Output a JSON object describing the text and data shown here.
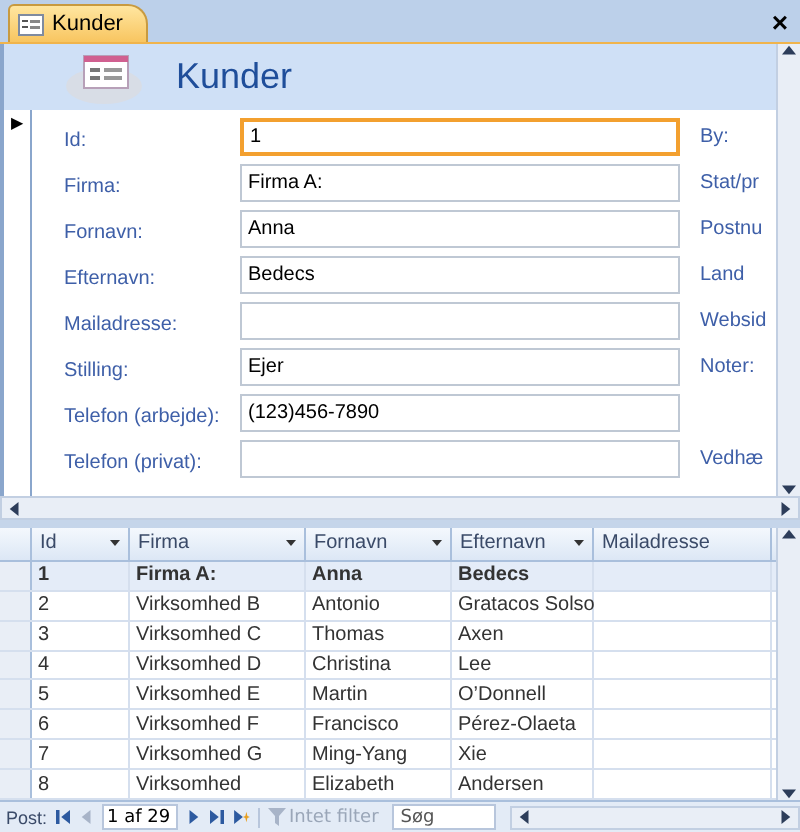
{
  "tab": {
    "label": "Kunder",
    "selected": true,
    "close": "×"
  },
  "form": {
    "title": "Kunder",
    "record_marker": "▶",
    "fields": [
      {
        "label": "Id:",
        "value": "1",
        "focused": true,
        "side_label": "By:"
      },
      {
        "label": "Firma:",
        "value": "Firma A:",
        "focused": false,
        "side_label": "Stat/pr"
      },
      {
        "label": "Fornavn:",
        "value": "Anna",
        "focused": false,
        "side_label": "Postnu"
      },
      {
        "label": "Efternavn:",
        "value": "Bedecs",
        "focused": false,
        "side_label": "Land"
      },
      {
        "label": "Mailadresse:",
        "focused": false,
        "side_label": "Websid"
      },
      {
        "label": "Stilling:",
        "value": "Ejer",
        "focused": false,
        "side_label": "Noter:"
      },
      {
        "label": "Telefon (arbejde):",
        "value": "(123)456-7890",
        "focused": false
      },
      {
        "label": "Telefon (privat):",
        "focused": false,
        "side_label": "Vedhæ"
      }
    ]
  },
  "datasheet": {
    "columns": [
      {
        "label": "Id",
        "dropdown": true
      },
      {
        "label": "Firma",
        "dropdown": true
      },
      {
        "label": "Fornavn",
        "dropdown": true
      },
      {
        "label": "Efternavn",
        "dropdown": true
      },
      {
        "label": "Mailadresse",
        "dropdown": false
      }
    ],
    "rows": [
      {
        "selected": true,
        "cells": [
          "1",
          "Firma A:",
          "Anna",
          "Bedecs"
        ]
      },
      {
        "selected": false,
        "cells": [
          "2",
          "Virksomhed B",
          "Antonio",
          "Gratacos Solso"
        ]
      },
      {
        "selected": false,
        "cells": [
          "3",
          "Virksomhed C",
          "Thomas",
          "Axen"
        ]
      },
      {
        "selected": false,
        "cells": [
          "4",
          "Virksomhed D",
          "Christina",
          "Lee"
        ]
      },
      {
        "selected": false,
        "cells": [
          "5",
          "Virksomhed E",
          "Martin",
          "O’Donnell"
        ]
      },
      {
        "selected": false,
        "cells": [
          "6",
          "Virksomhed F",
          "Francisco",
          "Pérez-Olaeta"
        ]
      },
      {
        "selected": false,
        "cells": [
          "7",
          "Virksomhed G",
          "Ming-Yang",
          "Xie"
        ]
      },
      {
        "selected": false,
        "cells": [
          "8",
          "Virksomhed",
          "Elizabeth",
          "Andersen"
        ]
      }
    ]
  },
  "navigator": {
    "label": "Post:",
    "position": "1 af 29",
    "filter": {
      "label": "Intet filter",
      "disabled": true
    },
    "search": {
      "placeholder": "Søg"
    }
  }
}
